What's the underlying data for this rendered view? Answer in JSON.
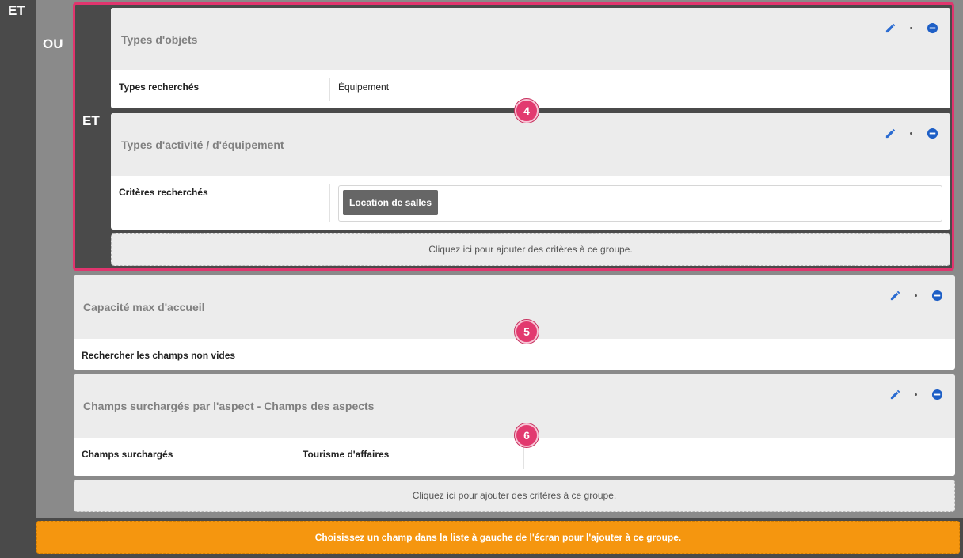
{
  "labels": {
    "outer_et": "ET",
    "ou": "OU",
    "inner_et": "ET"
  },
  "card1": {
    "title": "Types d'objets",
    "row_label": "Types recherchés",
    "row_value": "Équipement"
  },
  "card2": {
    "title": "Types d'activité / d'équipement",
    "row_label": "Critères recherchés",
    "tag": "Location de salles"
  },
  "card3": {
    "title": "Capacité max d'accueil",
    "row_label": "Rechercher les champs non vides"
  },
  "card4": {
    "title": "Champs surchargés par l'aspect - Champs des aspects",
    "row_label": "Champs surchargés",
    "row_value": "Tourisme d'affaires"
  },
  "add_zone_text": "Cliquez ici pour ajouter des critères à ce groupe.",
  "badges": [
    "4",
    "5",
    "6"
  ],
  "orange_bar_text": "Choisissez un champ dans la liste à gauche de l'écran pour l'ajouter à ce groupe.",
  "icons": {
    "edit": "pencil-icon",
    "remove": "minus-circle-icon"
  },
  "colors": {
    "accent": "#2a6bd1",
    "highlight": "#e0356e",
    "orange": "#f5960f",
    "badge": "#e23a6f"
  }
}
